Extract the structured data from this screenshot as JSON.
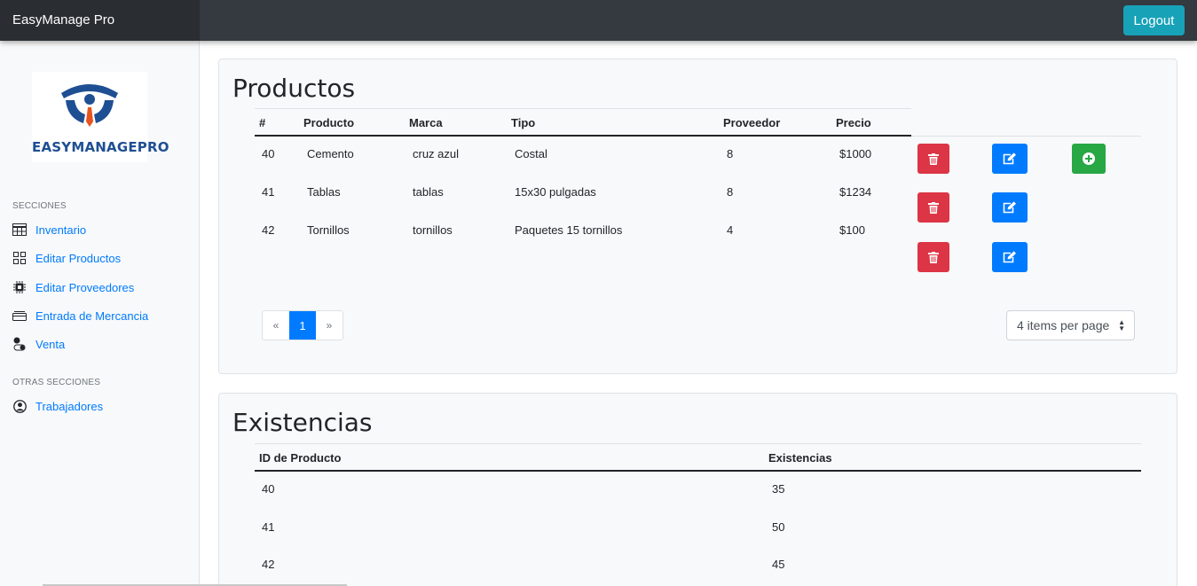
{
  "app": {
    "brand": "EasyManage Pro",
    "logout_label": "Logout",
    "logo_text": "EASYMANAGEPRO"
  },
  "sidebar": {
    "section1_heading": "SECCIONES",
    "items": [
      {
        "label": "Inventario",
        "icon": "table-icon"
      },
      {
        "label": "Editar Productos",
        "icon": "grid-icon"
      },
      {
        "label": "Editar Proveedores",
        "icon": "chip-icon"
      },
      {
        "label": "Entrada de Mercancia",
        "icon": "box-icon"
      },
      {
        "label": "Venta",
        "icon": "toggles-icon"
      }
    ],
    "section2_heading": "OTRAS SECCIONES",
    "items2": [
      {
        "label": "Trabajadores",
        "icon": "person-circle-icon"
      }
    ]
  },
  "productos": {
    "title": "Productos",
    "headers": [
      "#",
      "Producto",
      "Marca",
      "Tipo",
      "Proveedor",
      "Precio"
    ],
    "rows": [
      [
        "40",
        "Cemento",
        "cruz azul",
        "Costal",
        "8",
        "$1000"
      ],
      [
        "41",
        "Tablas",
        "tablas",
        "15x30 pulgadas",
        "8",
        "$1234"
      ],
      [
        "42",
        "Tornillos",
        "tornillos",
        "Paquetes 15 tornillos",
        "4",
        "$100"
      ]
    ],
    "pagination": {
      "prev": "«",
      "current": "1",
      "next": "»"
    },
    "per_page": "4 items per page"
  },
  "existencias": {
    "title": "Existencias",
    "headers": [
      "ID de Producto",
      "Existencias"
    ],
    "rows": [
      [
        "40",
        "35"
      ],
      [
        "41",
        "50"
      ],
      [
        "42",
        "45"
      ]
    ]
  },
  "colors": {
    "navbar": "#343a40",
    "logout": "#17a2b8",
    "delete": "#dc3545",
    "edit": "#007bff",
    "add": "#28a745",
    "link": "#007bff"
  }
}
